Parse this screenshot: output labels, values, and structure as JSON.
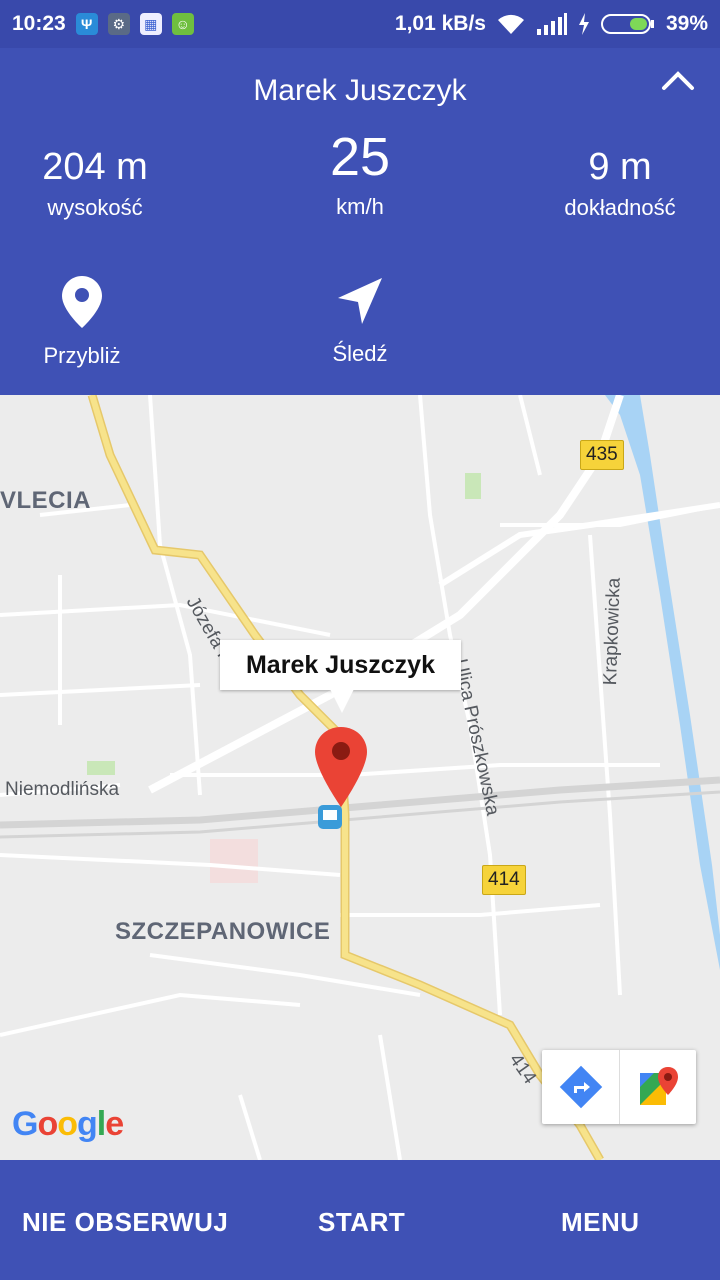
{
  "status_bar": {
    "time": "10:23",
    "speed": "1,01 kB/s",
    "battery": "39%",
    "icons": [
      "usb-icon",
      "settings-notification-icon",
      "calendar-notification-icon",
      "android-notification-icon",
      "wifi-icon",
      "signal-icon",
      "charging-icon",
      "battery-icon"
    ]
  },
  "header": {
    "name": "Marek Juszczyk",
    "stats": {
      "altitude_value": "204 m",
      "altitude_label": "wysokość",
      "speed_value": "25",
      "speed_label": "km/h",
      "accuracy_value": "9 m",
      "accuracy_label": "dokładność"
    },
    "actions": {
      "zoom_label": "Przybliż",
      "follow_label": "Śledź"
    }
  },
  "map": {
    "labels": {
      "district_top": "VLECIA",
      "district_bottom": "SZCZEPANOWICE",
      "street_jozefa": "Józefa H",
      "street_niemodlinska": "Niemodlińska",
      "street_prószkowska": "Ulica Prószkowska",
      "street_krapkowicka": "Krapkowicka",
      "road_435": "435",
      "road_414": "414",
      "road_414_b": "414"
    },
    "marker_title": "Marek Juszczyk",
    "attribution": "Google"
  },
  "bottom_bar": {
    "unfollow_label": "NIE OBSERWUJ",
    "start_label": "START",
    "menu_label": "MENU"
  },
  "colors": {
    "primary": "#3f51b5",
    "status_bar": "#3949ab",
    "marker": "#ea4335",
    "map_bg": "#ececec",
    "river": "#a8d3f5",
    "road_major": "#f7e38b"
  }
}
